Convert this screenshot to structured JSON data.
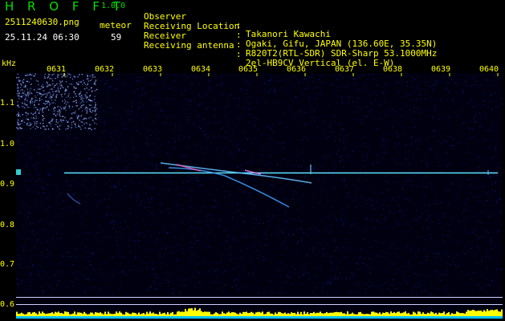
{
  "header": {
    "brand": "H R O F F T",
    "version": "1.0.0",
    "filename": "2511240630.png",
    "meteor_label": "meteor",
    "datetime": "25.11.24 06:30",
    "meteor_count": "59"
  },
  "info": [
    {
      "label": "Observer",
      "value": "Takanori Kawachi"
    },
    {
      "label": "Receiving Location",
      "value": "Ogaki, Gifu, JAPAN (136.60E, 35.35N)"
    },
    {
      "label": "Receiver",
      "value": "R820T2(RTL-SDR) SDR-Sharp 53.1000MHz"
    },
    {
      "label": "Receiving antenna",
      "value": "2el-HB9CV Vertical (el. E-W)"
    }
  ],
  "separator": ":",
  "y_unit": "kHz",
  "y_ticks": [
    "1.1",
    "1.0",
    "0.9",
    "0.8",
    "0.7",
    "0.6"
  ],
  "x_ticks": [
    "0631",
    "0632",
    "0633",
    "0634",
    "0635",
    "0636",
    "0637",
    "0638",
    "0639",
    "0640"
  ],
  "colors": {
    "background": "#000000",
    "noise": "#1010a0",
    "carrier": "#40e0ff",
    "echo": "#60c0ff",
    "bottom_bar": "#ffff00",
    "bottom_base": "#00c0ff",
    "green_text": "#00e000",
    "yellow_text": "#ffff00"
  }
}
